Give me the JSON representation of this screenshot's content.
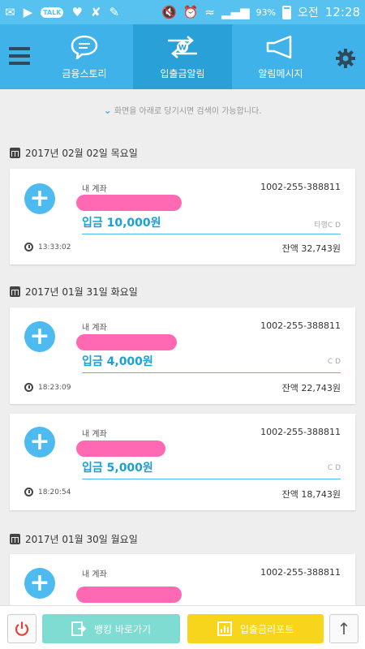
{
  "status_bar": {
    "left_icons": [
      "message-icon",
      "play-icon",
      "kakaotalk-icon",
      "heart-icon",
      "app-icon",
      "cleaner-icon"
    ],
    "talk_label": "TALK",
    "battery": "93%",
    "ampm": "오전",
    "time": "12:28"
  },
  "nav": {
    "tabs": [
      {
        "label": "금융스토리",
        "icon": "speech-bubble-icon"
      },
      {
        "label": "입출금알림",
        "icon": "transfer-icon"
      },
      {
        "label": "알림메시지",
        "icon": "megaphone-icon"
      }
    ],
    "selected_tab": 1
  },
  "hint": "화면을 아래로 당기시면 검색이 가능합니다.",
  "groups": [
    {
      "date": "2017년 02월 02일 목요일",
      "items": [
        {
          "account_label": "내 계좌",
          "account_number": "1002-255-388811",
          "amount": "입금 10,000원",
          "bank": "타행C D",
          "time": "13:33:02",
          "balance": "잔액 32,743원"
        }
      ]
    },
    {
      "date": "2017년 01월 31일 화요일",
      "items": [
        {
          "account_label": "내 계좌",
          "account_number": "1002-255-388811",
          "amount": "입금 4,000원",
          "bank": "C D",
          "time": "18:23:09",
          "balance": "잔액 22,743원"
        },
        {
          "account_label": "내 계좌",
          "account_number": "1002-255-388811",
          "amount": "입금 5,000원",
          "bank": "C D",
          "time": "18:20:54",
          "balance": "잔액 18,743원"
        }
      ]
    },
    {
      "date": "2017년 01월 30일 월요일",
      "items": [
        {
          "account_label": "내 계좌",
          "account_number": "1002-255-388811",
          "amount": "",
          "bank": "",
          "time": "",
          "balance": ""
        }
      ]
    }
  ],
  "bottom_bar": {
    "bank_link_label": "뱅킹 바로가기",
    "report_label": "입출금리포트"
  },
  "colors": {
    "header": "#3fb2ea",
    "selected_tab": "#29a0d8",
    "accent": "#4dbbef",
    "redaction": "#ff69b4",
    "bank_link": "#7edcd3",
    "report": "#f8d51d",
    "power": "#e0443a"
  }
}
